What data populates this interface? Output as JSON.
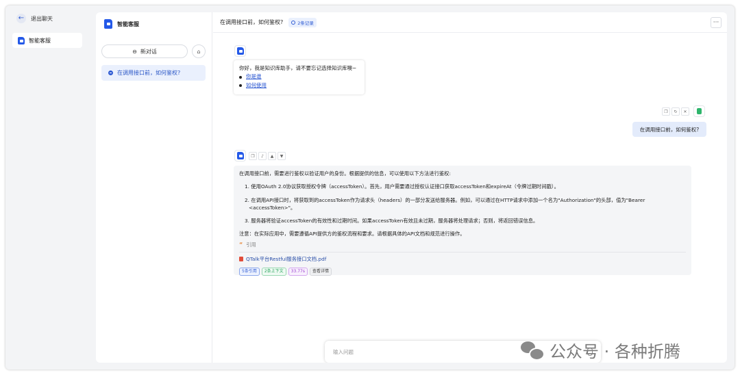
{
  "nav": {
    "exit_label": "退出聊天",
    "app_item_label": "智能客服"
  },
  "sidebar": {
    "title": "智能客服",
    "new_chat_label": "新对话",
    "conversations": [
      {
        "label": "在调用接口前，如何鉴权?"
      }
    ]
  },
  "chat": {
    "title": "在调用接口前，如何鉴权?",
    "record_badge": "2条记录",
    "more_label": "···",
    "welcome": {
      "text": "你好，我是知识库助手，请不要忘记选择知识库噢~",
      "links": [
        "你是谁",
        "如何使用"
      ]
    },
    "user_message": "在调用接口前，如何鉴权?",
    "answer": {
      "intro": "在调用接口前，需要进行鉴权以验证用户的身份。根据提供的信息，可以使用以下方法进行鉴权:",
      "steps": [
        "1. 使用OAuth 2.0协议获取授权令牌（accessToken）。首先，用户需要通过授权认证接口获取accessToken和expireAt（令牌过期时间戳）。",
        "2. 在调用API接口时，将获取到的accessToken作为请求头（headers）的一部分发送给服务器。例如，可以通过在HTTP请求中添加一个名为\"Authorization\"的头部，值为\"Bearer <accessToken>\"。",
        "3. 服务器将验证accessToken的有效性和过期时间。如果accessToken有效且未过期，服务器将处理请求；否则，将返回错误信息。"
      ],
      "note": "注意：在实际应用中，需要遵循API提供方的鉴权流程和要求。请根据具体的API文档和规范进行操作。",
      "citation_label": "引用",
      "file_name": "QTalk平台Restful服务接口文档.pdf",
      "tags": [
        "5条引用",
        "2条上下文",
        "33.77s",
        "查看详情"
      ]
    },
    "input": {
      "placeholder": "输入问题"
    }
  },
  "watermark": {
    "text": "公众号 · 各种折腾"
  },
  "colors": {
    "accent": "#2f5bd3",
    "user_bubble": "#e3ebfb",
    "frame_bg": "#f3f4f6"
  }
}
